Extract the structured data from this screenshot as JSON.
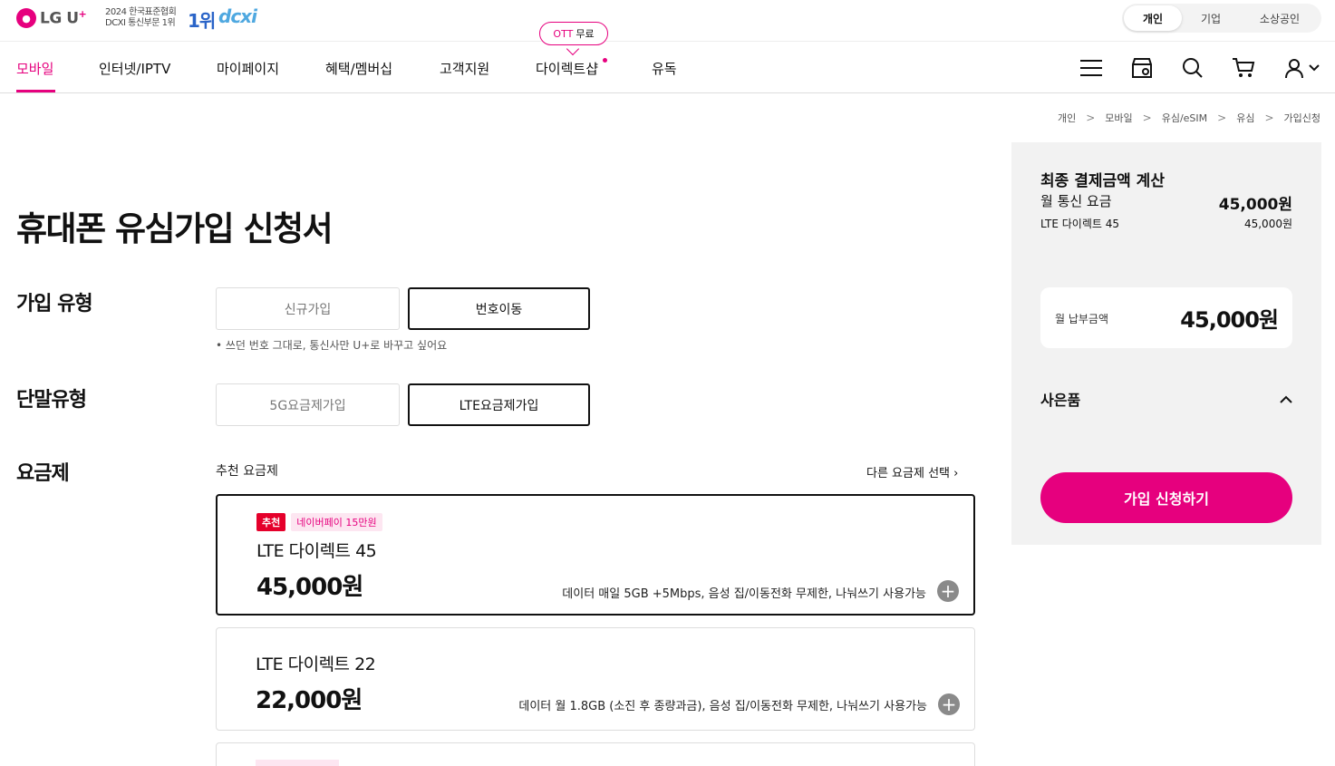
{
  "header": {
    "logo_mark": "●",
    "logo_text": "LG U",
    "logo_plus": "+",
    "award_line1": "2024 한국표준협회",
    "award_line2": "DCXI 통신부문 1위",
    "award_rank": "1위",
    "award_logo": "dcxi",
    "segments": [
      "개인",
      "기업",
      "소상공인"
    ]
  },
  "gnb": {
    "items": [
      "모바일",
      "인터넷/IPTV",
      "마이페이지",
      "혜택/멤버십",
      "고객지원",
      "다이렉트샵",
      "유독"
    ],
    "ott_badge_accent": "OTT",
    "ott_badge_text": "무료"
  },
  "breadcrumb": [
    "개인",
    "모바일",
    "유심/eSIM",
    "유심",
    "가입신청"
  ],
  "main": {
    "title": "휴대폰 유심가입 신청서",
    "join_type": {
      "label": "가입 유형",
      "options": [
        "신규가입",
        "번호이동"
      ],
      "selected": "번호이동",
      "hint": "• 쓰던 번호 그대로, 통신사만 U+로 바꾸고 싶어요"
    },
    "device_type": {
      "label": "단말유형",
      "options": [
        "5G요금제가입",
        "LTE요금제가입"
      ],
      "selected": "LTE요금제가입"
    },
    "plan": {
      "label": "요금제",
      "recommended_label": "추천 요금제",
      "other_link": "다른 요금제 선택 ›",
      "cards": [
        {
          "badge_rec": "추천",
          "badge_pay": "네이버페이 15만원",
          "name": "LTE 다이렉트 45",
          "price": "45,000원",
          "desc": "데이터 매일 5GB +5Mbps, 음성 집/이동전화 무제한, 나눠쓰기 사용가능"
        },
        {
          "name": "LTE 다이렉트 22",
          "price": "22,000원",
          "desc": "데이터 월 1.8GB (소진 후 종량과금), 음성 집/이동전화 무제한, 나눠쓰기 사용가능"
        }
      ]
    }
  },
  "side": {
    "title": "최종 결제금액 계산",
    "monthly_label": "월 통신 요금",
    "monthly_value": "45,000원",
    "plan_label": "LTE 다이렉트 45",
    "plan_value": "45,000원",
    "pay_label": "월 납부금액",
    "pay_value": "45,000원",
    "gift_label": "사은품",
    "apply_button": "가입 신청하기"
  },
  "colors": {
    "brand": "#e6007e",
    "recommend": "#e5002b"
  }
}
